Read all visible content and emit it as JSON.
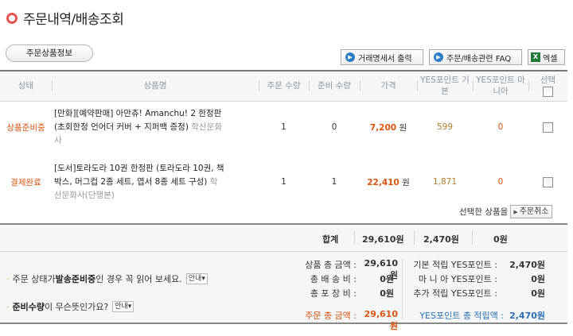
{
  "header": {
    "title": "주문내역/배송조회"
  },
  "tab": {
    "label": "주문상품정보"
  },
  "toolbar": {
    "receipt_label": "거래명세서 출력",
    "faq_label": "주문/배송관련 FAQ",
    "excel_label": "엑셀"
  },
  "table": {
    "headers": {
      "status": "상태",
      "product": "상품명",
      "order_qty": "주문 수량",
      "ready_qty": "준비 수량",
      "price": "가격",
      "yes_point_basic": "YES포인트 기본",
      "yes_point_mania": "YES포인트 마니아",
      "select": "선택"
    },
    "rows": [
      {
        "status": "상품준비중",
        "product_line1": "[만화][예약판매] 아만츄! Amanchu! 2 한정판",
        "product_line2": "(초회한정 언어더 커버 + 지퍼백 증정)",
        "publisher_part1": " 학산문화",
        "publisher_part2": "사",
        "order_qty": "1",
        "ready_qty": "0",
        "price": "7,200",
        "price_unit": "원",
        "point_basic": "599",
        "point_mania": "0"
      },
      {
        "status": "결제완료",
        "product_line1": "[도서]토라도라 10권 한정판 (토라도라 10권, 책",
        "product_line2": "박스, 머그컵 2종 세트, 엽서 8종 세트 구성)",
        "publisher_part1": " 학",
        "publisher_part2": "산문화사(단행본)",
        "order_qty": "1",
        "ready_qty": "1",
        "price": "22,410",
        "price_unit": "원",
        "point_basic": "1,871",
        "point_mania": "0"
      }
    ]
  },
  "cancel": {
    "label": "선택한 상품을",
    "button_label": "주문취소"
  },
  "totals": {
    "label": "합계",
    "price": "29,610원",
    "point_basic": "2,470원",
    "point_mania": "0원"
  },
  "notices": [
    {
      "pre": "주문 상태가 ",
      "bold": "발송준비중",
      "post": "인 경우 꼭 읽어 보세요.",
      "button": "안내"
    },
    {
      "pre": "",
      "bold": "준비수량",
      "post": "이 무슨뜻인가요?",
      "button": "안내"
    }
  ],
  "summary": {
    "product_total_label": "상품 총 금액 :",
    "product_total_value": "29,610원",
    "shipping_label": "총 배 송 비 :",
    "shipping_value": "0원",
    "packaging_label": "총 포 장 비 :",
    "packaging_value": "0원",
    "order_total_label": "주문 총 금액 :",
    "order_total_value": "29,610원",
    "basic_points_label": "기본 적립 YES포인트 :",
    "basic_points_value": "2,470원",
    "mania_label": "마 니 아 YES포인트 :",
    "mania_value": "0원",
    "extra_label": "추가 적립 YES포인트 :",
    "extra_value": "0원",
    "total_points_label": "YES포인트 총 적립액 :",
    "total_points_value": "2,470원"
  },
  "colors": {
    "status": "#d9530f",
    "point_blue": "#2a6fb5",
    "accent_icon": "#e8534e"
  }
}
